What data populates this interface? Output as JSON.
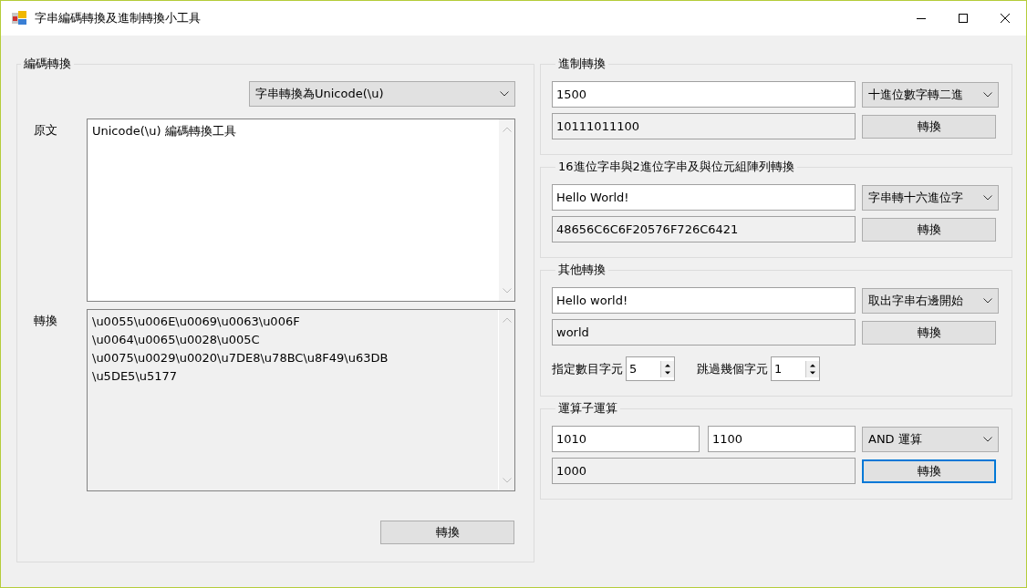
{
  "window": {
    "title": "字串編碼轉換及進制轉換小工具"
  },
  "encoding": {
    "title": "編碼轉換",
    "dropdown": "字串轉換為Unicode(\\u)",
    "source_label": "原文",
    "source_text": "Unicode(\\u) 編碼轉換工具",
    "result_label": "轉換",
    "result_lines": [
      "\\u0055\\u006E\\u0069\\u0063\\u006F",
      "\\u0064\\u0065\\u0028\\u005C",
      "\\u0075\\u0029\\u0020\\u7DE8\\u78BC\\u8F49\\u63DB",
      "\\u5DE5\\u5177"
    ],
    "button": {
      "label": "轉換",
      "focused": false
    }
  },
  "groups": [
    {
      "title": "進制轉換",
      "inputs": [
        "1500"
      ],
      "dropdown": "十進位數字轉二進",
      "output": "10111011100",
      "button": {
        "label": "轉換",
        "focused": false
      }
    },
    {
      "title": "16進位字串與2進位字串及與位元組陣列轉換",
      "inputs": [
        "Hello World!"
      ],
      "dropdown": "字串轉十六進位字",
      "output": "48656C6C6F20576F726C6421",
      "button": {
        "label": "轉換",
        "focused": false
      }
    },
    {
      "title": "其他轉換",
      "inputs": [
        "Hello world!"
      ],
      "dropdown": "取出字串右邊開始",
      "output": "world",
      "button": {
        "label": "轉換",
        "focused": false
      },
      "spinners": [
        {
          "label": "指定數目字元",
          "value": "5"
        },
        {
          "label": "跳過幾個字元",
          "value": "1"
        }
      ]
    },
    {
      "title": "運算子運算",
      "inputs": [
        "1010",
        "1100"
      ],
      "dropdown": "AND 運算",
      "output": "1000",
      "button": {
        "label": "轉換",
        "focused": true
      }
    }
  ]
}
